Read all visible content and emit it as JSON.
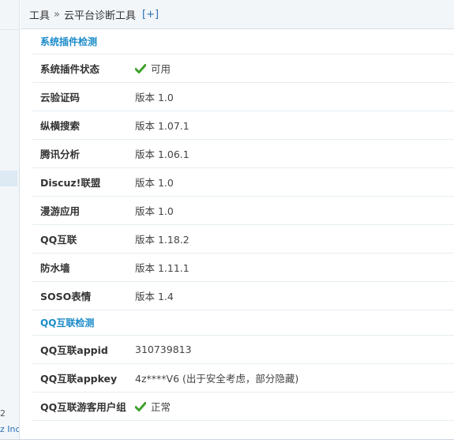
{
  "breadcrumb": {
    "root": "工具",
    "separator": "»",
    "current": "云平台诊断工具",
    "add": "[+]"
  },
  "sidebar_fragment": {
    "line1": "2",
    "line2": "z Inc."
  },
  "plugin_section": {
    "title": "系统插件检测",
    "rows": [
      {
        "label": "系统插件状态",
        "value": "可用",
        "icon": "check-icon"
      },
      {
        "label": "云验证码",
        "value": "版本 1.0"
      },
      {
        "label": "纵横搜索",
        "value": "版本 1.07.1"
      },
      {
        "label": "腾讯分析",
        "value": "版本 1.06.1"
      },
      {
        "label": "Discuz!联盟",
        "value": "版本 1.0"
      },
      {
        "label": "漫游应用",
        "value": "版本 1.0"
      },
      {
        "label": "QQ互联",
        "value": "版本 1.18.2"
      },
      {
        "label": "防水墙",
        "value": "版本 1.11.1"
      },
      {
        "label": "SOSO表情",
        "value": "版本 1.4"
      }
    ]
  },
  "qq_section": {
    "title": "QQ互联检测",
    "rows": [
      {
        "label": "QQ互联appid",
        "value": "310739813"
      },
      {
        "label": "QQ互联appkey",
        "value": "4z****V6 (出于安全考虑，部分隐藏)"
      },
      {
        "label": "QQ互联游客用户组",
        "value": "正常",
        "icon": "check-icon"
      }
    ]
  },
  "colors": {
    "section_title": "#1a8bc9",
    "check": "#3fa12e",
    "breadcrumb_bg": "#f2f6f9"
  }
}
